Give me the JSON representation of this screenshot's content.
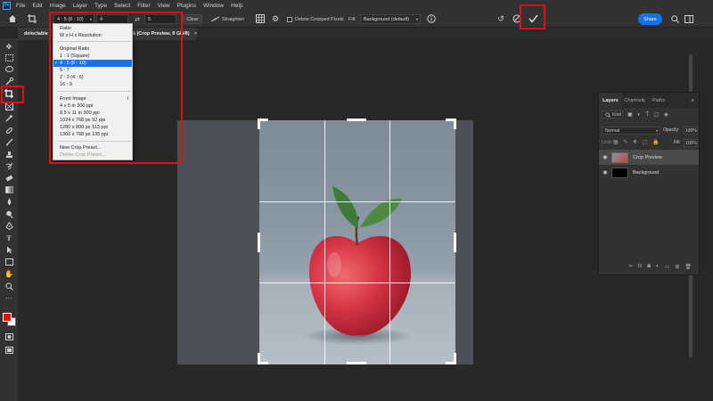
{
  "menubar": {
    "logo": "Ps",
    "items": [
      "File",
      "Edit",
      "Image",
      "Layer",
      "Type",
      "Select",
      "Filter",
      "View",
      "Plugins",
      "Window",
      "Help"
    ]
  },
  "options_bar": {
    "ratio_value": "4 : 5 (8 : 10)",
    "width_value": "4",
    "height_value": "5",
    "clear_label": "Clear",
    "straighten_label": "Straighten",
    "delete_cropped_label": "Delete Cropped Pixels",
    "fill_label": "Fill:",
    "fill_value": "Background (default)",
    "share_label": "Share"
  },
  "tabs": {
    "doc_tab_left": "delectable",
    "doc_tab_right": "7% (Crop Preview, 8 GB/8)"
  },
  "ratio_dropdown": {
    "items": [
      {
        "label": "Ratio",
        "state": "normal"
      },
      {
        "label": "W x H x Resolution",
        "state": "normal"
      },
      {
        "label": "Original Ratio",
        "state": "normal"
      },
      {
        "label": "1 : 1 (Square)",
        "state": "normal"
      },
      {
        "label": "4 : 5 (8 : 10)",
        "state": "selected"
      },
      {
        "label": "5 : 7",
        "state": "normal"
      },
      {
        "label": "2 : 3 (4 : 6)",
        "state": "normal"
      },
      {
        "label": "16 : 9",
        "state": "normal"
      },
      {
        "label": "Front Image",
        "state": "normal"
      },
      {
        "label": "4 x 5 in 300 ppi",
        "state": "normal"
      },
      {
        "label": "8.5 x 11 in 300 ppi",
        "state": "normal"
      },
      {
        "label": "1024 x 768 px 92 ppi",
        "state": "normal"
      },
      {
        "label": "1280 x 800 px 113 ppi",
        "state": "normal"
      },
      {
        "label": "1366 x 768 px 135 ppi",
        "state": "normal"
      },
      {
        "label": "New Crop Preset...",
        "state": "normal"
      },
      {
        "label": "Delete Crop Preset...",
        "state": "disabled"
      }
    ],
    "front_image_shortcut": "I"
  },
  "layers_panel": {
    "tabs": [
      "Layers",
      "Channels",
      "Paths"
    ],
    "kind_label": "Kind",
    "blend_mode": "Normal",
    "opacity_label": "Opacity:",
    "opacity_value": "100%",
    "lock_label": "Lock:",
    "fill_label": "Fill:",
    "fill_value": "100%",
    "layers": [
      {
        "name": "Crop Preview",
        "selected": true
      },
      {
        "name": "Background",
        "selected": false
      }
    ]
  },
  "colors": {
    "accent": "#1473e6",
    "highlight_box": "#dd1111",
    "foreground_swatch": "#e01010",
    "background_swatch": "#ffffff"
  },
  "icons": {
    "home": "home-icon",
    "crop": "crop-icon",
    "swap": "swap-icon",
    "grid_overlay": "grid-icon",
    "settings": "gear-icon",
    "reset": "reset-icon",
    "cancel": "cancel-icon",
    "commit": "checkmark-icon"
  }
}
